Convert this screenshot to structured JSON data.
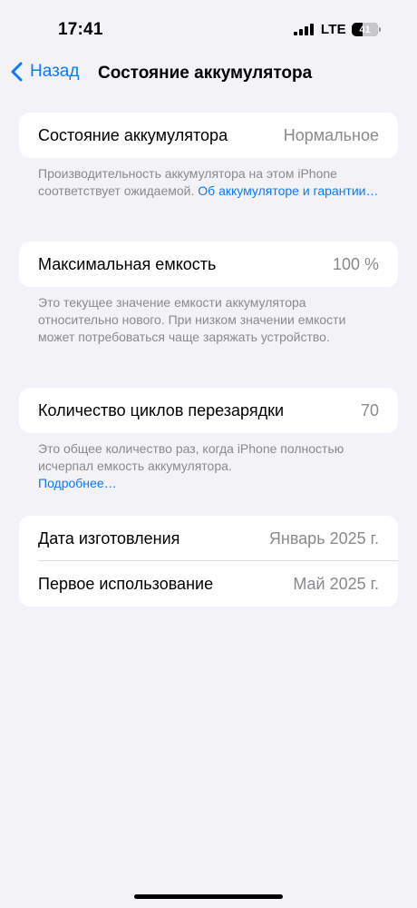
{
  "status_bar": {
    "time": "17:41",
    "network": "LTE",
    "battery_level": "41",
    "battery_fraction": 0.41,
    "signal_bars": 4
  },
  "nav": {
    "back_label": "Назад",
    "title": "Состояние аккумулятора"
  },
  "battery_health": {
    "label": "Состояние аккумулятора",
    "value": "Нормальное",
    "footnote_text": "Производительность аккумулятора на этом iPhone соответствует ожидаемой. ",
    "footnote_link": "Об аккумуля­торе и гарантии…"
  },
  "max_capacity": {
    "label": "Максимальная емкость",
    "value": "100 %",
    "footnote_text": "Это текущее значение емкости аккумулятора относительно нового. При низком значении емкости может потребоваться чаще заряжать устройство."
  },
  "cycle_count": {
    "label": "Количество циклов перезарядки",
    "value": "70",
    "footnote_text": "Это общее количество раз, когда iPhone полностью исчерпал емкость аккумулятора.",
    "footnote_link": "Подробнее…"
  },
  "dates": {
    "manufacture_label": "Дата изготовления",
    "manufacture_value": "Январь 2025 г.",
    "first_use_label": "Первое использование",
    "first_use_value": "Май 2025 г."
  },
  "colors": {
    "accent": "#0a7aff",
    "background": "#f2f2f7",
    "secondary_text": "#8a8a8e"
  }
}
